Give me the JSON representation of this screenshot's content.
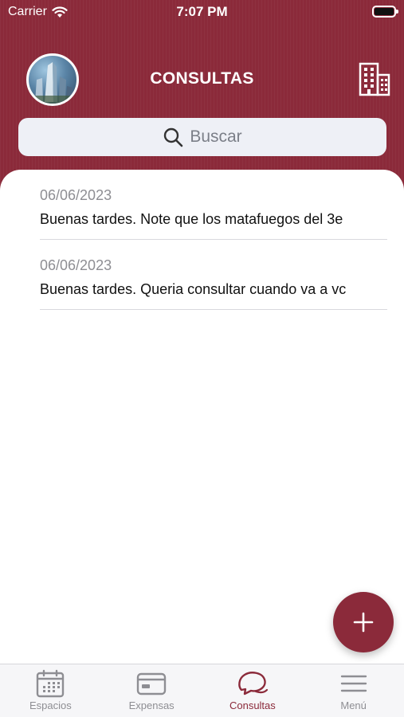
{
  "status_bar": {
    "carrier": "Carrier",
    "time": "7:07 PM"
  },
  "header": {
    "title": "CONSULTAS",
    "background_color": "#8b2a3a"
  },
  "search": {
    "placeholder": "Buscar",
    "icon": "magnifier-icon"
  },
  "consultas": [
    {
      "date": "06/06/2023",
      "text": "Buenas tardes. Note que los matafuegos del 3e"
    },
    {
      "date": "06/06/2023",
      "text": "Buenas tardes. Queria consultar cuando va a vc"
    }
  ],
  "fab": {
    "icon": "plus-icon"
  },
  "tabbar": {
    "active_color": "#8b2a3a",
    "tabs": [
      {
        "label": "Espacios",
        "icon": "calendar-icon",
        "active": false
      },
      {
        "label": "Expensas",
        "icon": "credit-card-icon",
        "active": false
      },
      {
        "label": "Consultas",
        "icon": "chat-bubbles-icon",
        "active": true
      },
      {
        "label": "Menú",
        "icon": "hamburger-menu-icon",
        "active": false
      }
    ]
  }
}
